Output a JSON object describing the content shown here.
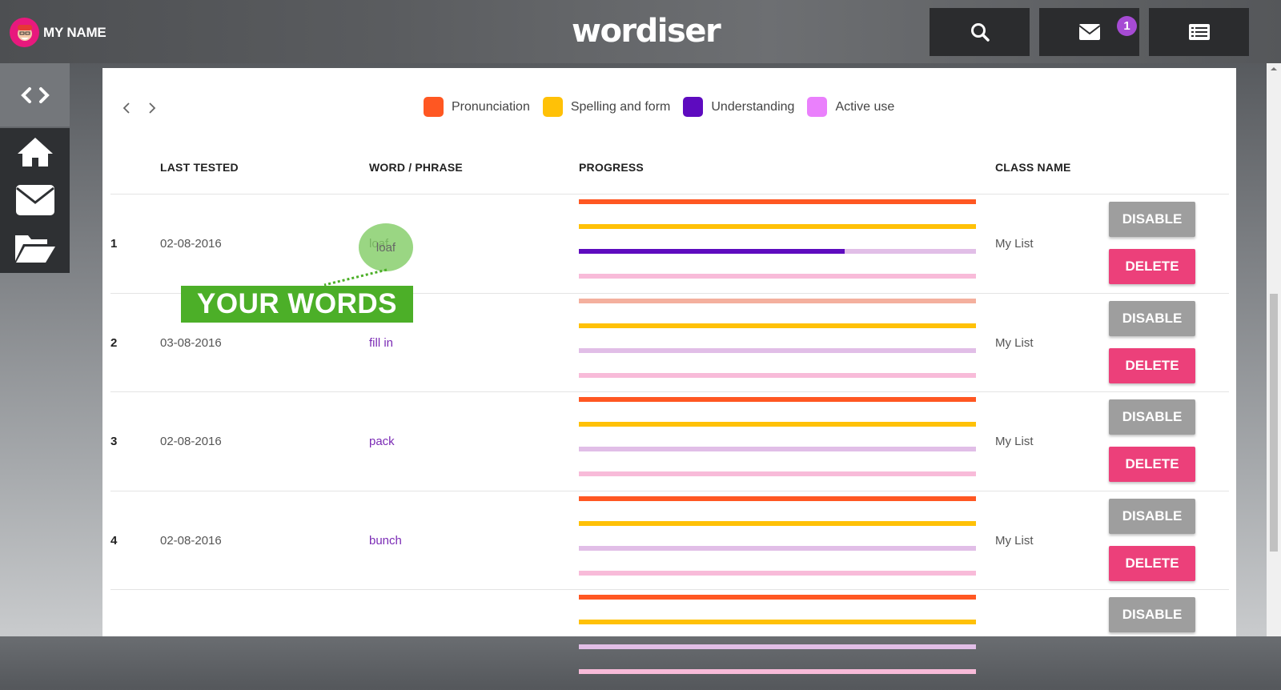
{
  "header": {
    "user_name": "MY NAME",
    "logo": "wordiser",
    "message_count": "1"
  },
  "legend": [
    {
      "label": "Pronunciation",
      "color": "#ff5722"
    },
    {
      "label": "Spelling and form",
      "color": "#ffc107"
    },
    {
      "label": "Understanding",
      "color": "#5e0bbf"
    },
    {
      "label": "Active use",
      "color": "#ea80fc"
    }
  ],
  "table": {
    "headers": {
      "last_tested": "LAST TESTED",
      "word": "WORD / PHRASE",
      "progress": "PROGRESS",
      "class_name": "CLASS NAME"
    },
    "disable_label": "DISABLE",
    "delete_label": "DELETE",
    "rows": [
      {
        "num": "1",
        "date": "02-08-2016",
        "word": "loaf",
        "class": "My List",
        "progress": {
          "pronunciation": 1,
          "spelling": 1,
          "understanding": 0.67,
          "active": 0
        }
      },
      {
        "num": "2",
        "date": "03-08-2016",
        "word": "fill in",
        "class": "My List",
        "progress": {
          "pronunciation": 0,
          "spelling": 1,
          "understanding": 0,
          "active": 0
        }
      },
      {
        "num": "3",
        "date": "02-08-2016",
        "word": "pack",
        "class": "My List",
        "progress": {
          "pronunciation": 1,
          "spelling": 1,
          "understanding": 0,
          "active": 0
        }
      },
      {
        "num": "4",
        "date": "02-08-2016",
        "word": "bunch",
        "class": "My List",
        "progress": {
          "pronunciation": 1,
          "spelling": 1,
          "understanding": 0,
          "active": 0
        }
      },
      {
        "num": "",
        "date": "",
        "word": "",
        "class": "",
        "progress": {
          "pronunciation": 1,
          "spelling": 1,
          "understanding": 0,
          "active": 0
        }
      }
    ]
  },
  "callout": {
    "label": "YOUR WORDS"
  }
}
